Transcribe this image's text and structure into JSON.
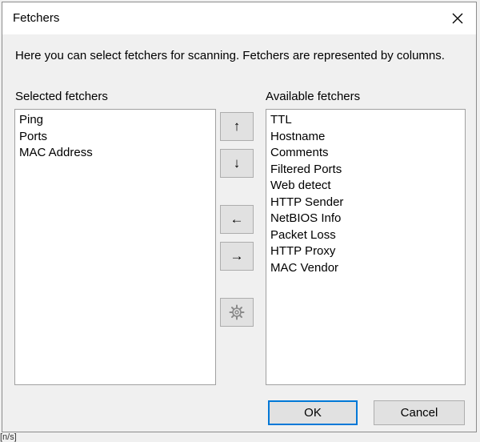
{
  "window": {
    "title": "Fetchers"
  },
  "description": "Here you can select fetchers for scanning. Fetchers are represented by columns.",
  "selected": {
    "label": "Selected fetchers",
    "items": [
      "Ping",
      "Ports",
      "MAC Address"
    ]
  },
  "available": {
    "label": "Available fetchers",
    "items": [
      "TTL",
      "Hostname",
      "Comments",
      "Filtered Ports",
      "Web detect",
      "HTTP Sender",
      "NetBIOS Info",
      "Packet Loss",
      "HTTP Proxy",
      "MAC Vendor"
    ]
  },
  "controls": {
    "move_up_glyph": "↑",
    "move_down_glyph": "↓",
    "move_left_glyph": "←",
    "move_right_glyph": "→",
    "settings_icon": "gear-icon"
  },
  "buttons": {
    "ok_label": "OK",
    "cancel_label": "Cancel"
  },
  "background": {
    "partial_text": "[n/s]"
  },
  "colors": {
    "default_button_border": "#0078d7",
    "title_bar": "#ffffff",
    "dialog_bg": "#f0f0f0"
  }
}
